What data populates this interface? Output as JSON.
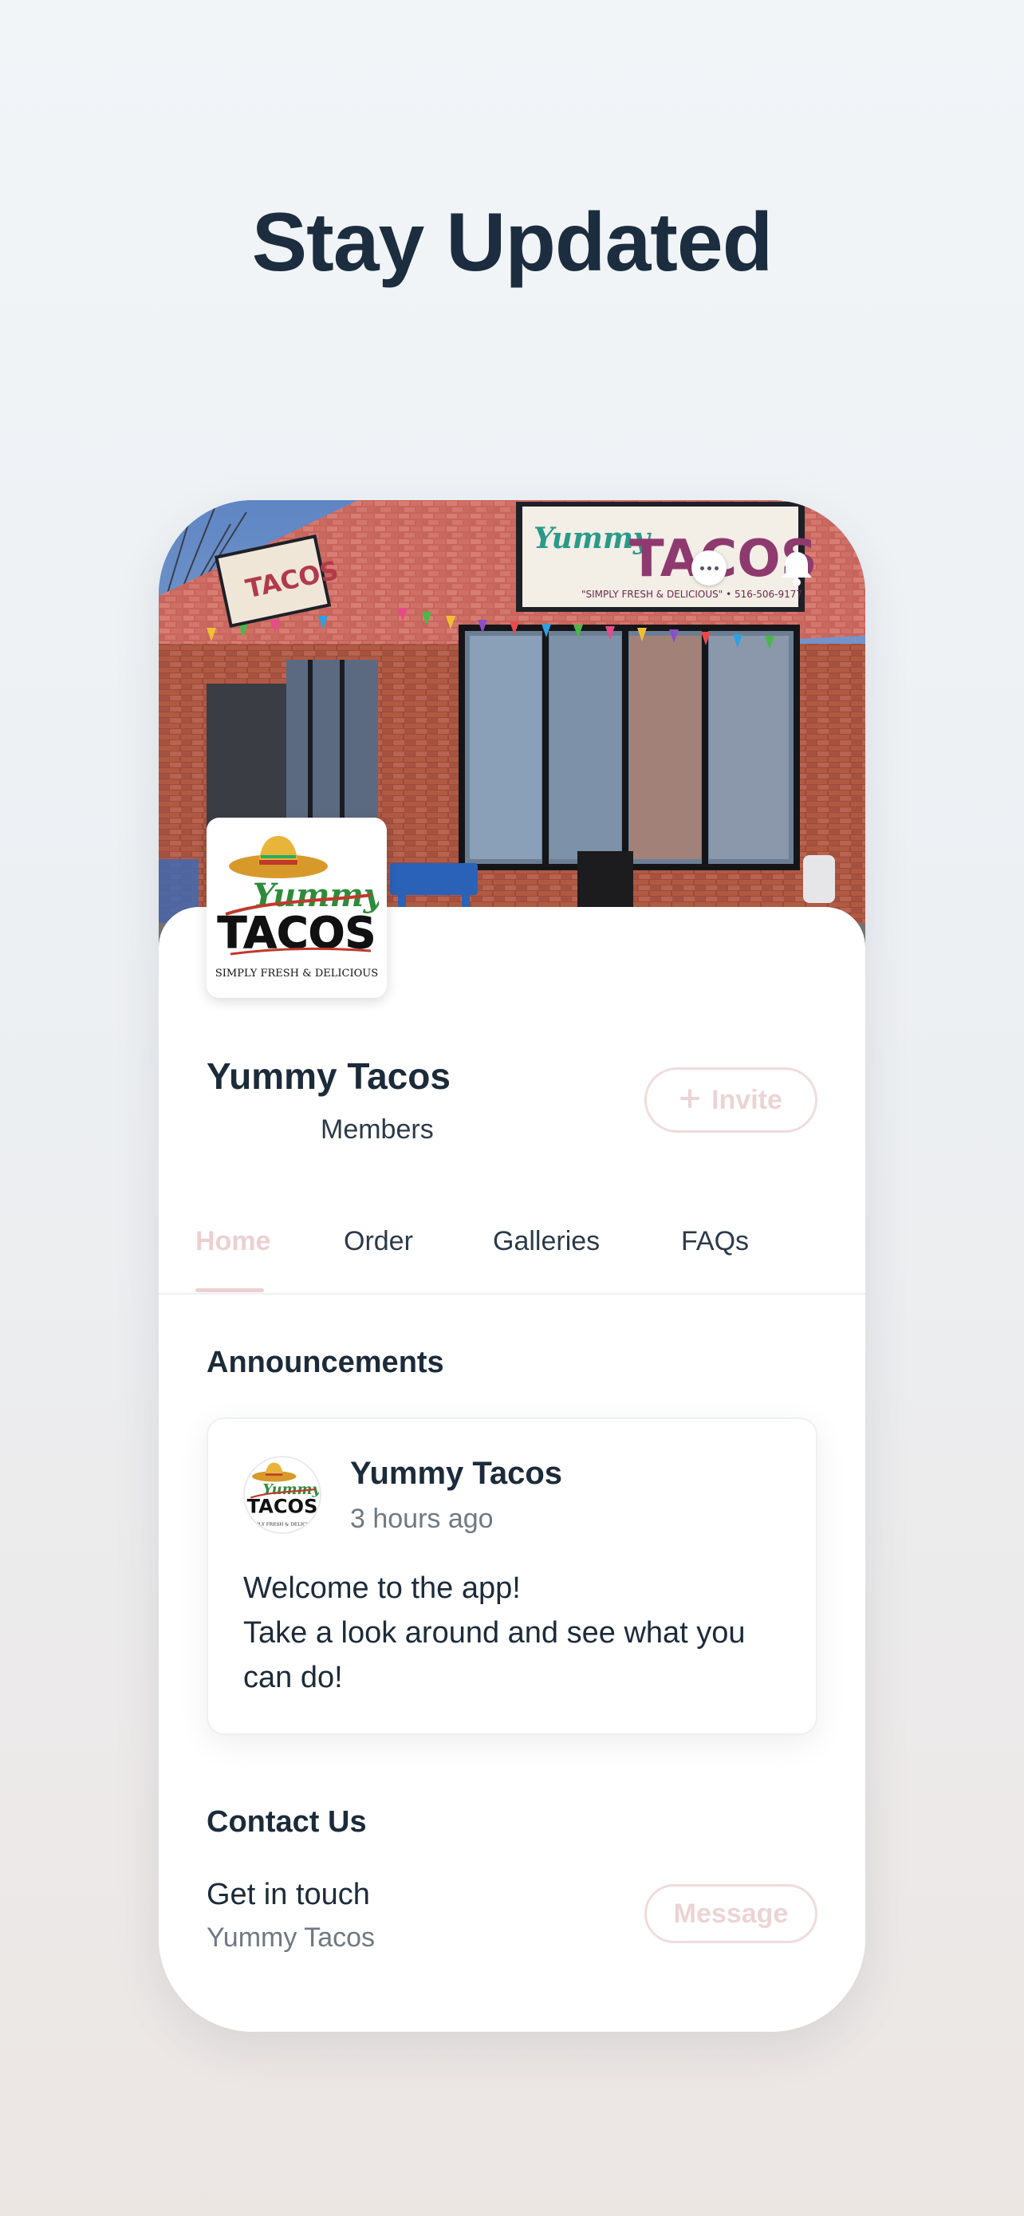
{
  "headline": "Stay Updated",
  "site": {
    "name": "Yummy Tacos",
    "members_label": "Members",
    "invite_label": "Invite"
  },
  "logo": {
    "brand_script": "Yummy",
    "brand_main": "TACOS",
    "tagline": "SIMPLY FRESH & DELICIOUS"
  },
  "cover": {
    "sign_script": "Yummy",
    "sign_main": "TACOS",
    "sign_tagline": "\"SIMPLY FRESH & DELICIOUS\" • 516-506-9177",
    "side_sign": "TACOS"
  },
  "tabs": [
    {
      "label": "Home",
      "active": true
    },
    {
      "label": "Order",
      "active": false
    },
    {
      "label": "Galleries",
      "active": false
    },
    {
      "label": "FAQs",
      "active": false
    }
  ],
  "announcements": {
    "title": "Announcements",
    "post": {
      "author": "Yummy Tacos",
      "time": "3 hours ago",
      "body_line1": "Welcome to the app!",
      "body_line2": "Take a look around and see what you can do!"
    }
  },
  "contact": {
    "title": "Contact Us",
    "line": "Get in touch",
    "sub": "Yummy Tacos",
    "message_label": "Message"
  },
  "colors": {
    "accent_pale": "#ecd0d0",
    "text_dark": "#1c2b3a",
    "text_muted": "#6f7983"
  }
}
